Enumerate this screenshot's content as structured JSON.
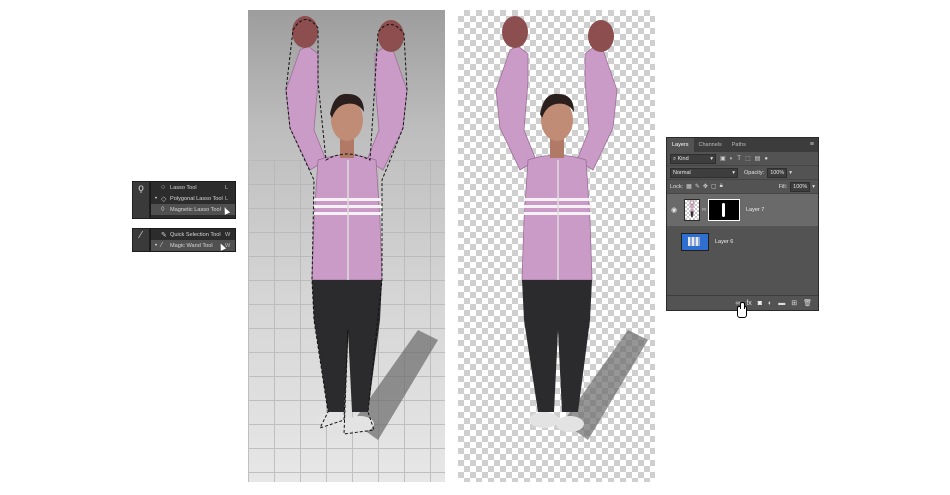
{
  "lasso_group": {
    "button_icon": "lasso-icon",
    "items": [
      {
        "label": "Lasso Tool",
        "key": "L",
        "selected": false,
        "current": false
      },
      {
        "label": "Polygonal Lasso Tool",
        "key": "L",
        "selected": true,
        "current": false
      },
      {
        "label": "Magnetic Lasso Tool",
        "key": "L",
        "selected": false,
        "current": true
      }
    ]
  },
  "wand_group": {
    "button_icon": "magic-wand-icon",
    "items": [
      {
        "label": "Quick Selection Tool",
        "key": "W",
        "selected": false,
        "current": false
      },
      {
        "label": "Magic Wand Tool",
        "key": "W",
        "selected": true,
        "current": true
      }
    ]
  },
  "layers_panel": {
    "tabs": [
      "Layers",
      "Channels",
      "Paths"
    ],
    "active_tab": "Layers",
    "filter": {
      "label": "Kind"
    },
    "blend_mode": "Normal",
    "opacity": {
      "label": "Opacity:",
      "value": "100%"
    },
    "lock": {
      "label": "Lock:"
    },
    "fill": {
      "label": "Fill:",
      "value": "100%"
    },
    "layers": [
      {
        "name": "Layer 7",
        "visible": true,
        "selected": true,
        "has_mask": true
      },
      {
        "name": "Layer 6",
        "visible": false,
        "selected": false,
        "has_mask": false
      }
    ],
    "footer_icons": [
      "link-icon",
      "fx-icon",
      "add-mask-icon",
      "adjustment-icon",
      "folder-icon",
      "new-layer-icon",
      "trash-icon"
    ]
  },
  "colors": {
    "panel_bg": "#535353",
    "tab_bar": "#3c3c3c",
    "selected_layer": "#6a6a6a",
    "jacket": "#c99bc6",
    "leggings": "#2b2b2d"
  }
}
